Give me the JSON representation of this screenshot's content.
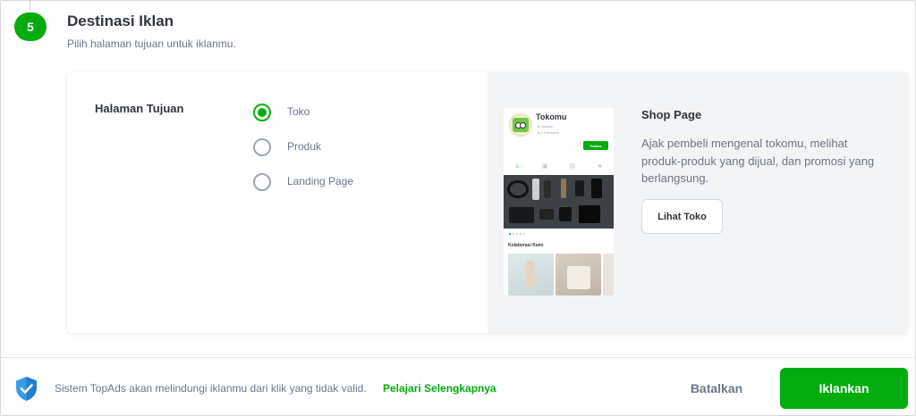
{
  "step": {
    "number": "5",
    "title": "Destinasi Iklan",
    "subtitle": "Pilih halaman tujuan untuk iklanmu."
  },
  "destination": {
    "label": "Halaman Tujuan",
    "options": [
      {
        "label": "Toko",
        "checked": true
      },
      {
        "label": "Produk",
        "checked": false
      },
      {
        "label": "Landing Page",
        "checked": false
      }
    ]
  },
  "preview": {
    "shop_name": "Tokomu",
    "location": "Jakarta",
    "followers": "0 Followers",
    "follow_label": "Follow",
    "section_title": "Kolaborasi Kami",
    "tab_icons": [
      "home-icon",
      "products-icon",
      "showcase-icon",
      "star-icon"
    ],
    "tab_glyphs": [
      "⌂",
      "▣",
      "▤",
      "★"
    ]
  },
  "shop_page": {
    "title": "Shop Page",
    "description": "Ajak pembeli mengenal tokomu, melihat produk-produk yang dijual, dan promosi yang berlangsung.",
    "button_label": "Lihat Toko"
  },
  "footer": {
    "protection_text": "Sistem TopAds akan melindungi iklanmu dari klik yang tidak valid.",
    "learn_more": "Pelajari Selengkapnya",
    "cancel_label": "Batalkan",
    "submit_label": "Iklankan"
  },
  "colors": {
    "accent": "#03ac0e",
    "shield": "#3a9be8"
  }
}
